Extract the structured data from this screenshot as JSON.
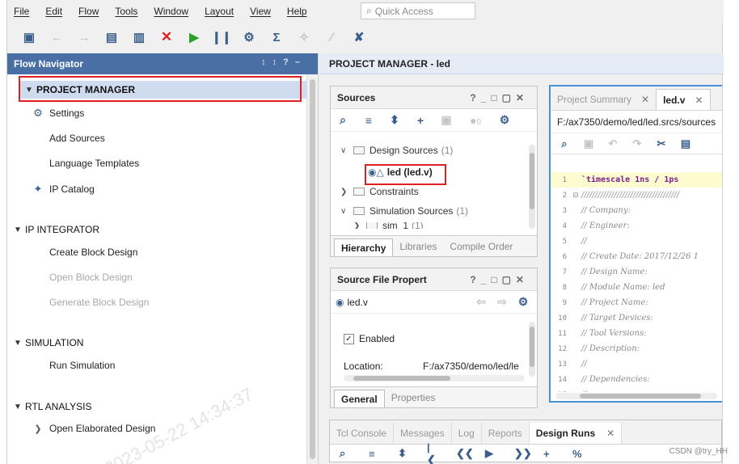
{
  "menubar": {
    "items": [
      "File",
      "Edit",
      "Flow",
      "Tools",
      "Window",
      "Layout",
      "View",
      "Help"
    ],
    "quick_access_placeholder": "Quick Access"
  },
  "toolbar": {
    "icons": [
      "open-project-icon",
      "undo-icon",
      "redo-icon",
      "copy-icon",
      "paste-icon",
      "delete-icon",
      "run-icon",
      "step-icon",
      "settings-icon",
      "sigma-icon",
      "disabled-tool-icon",
      "disabled-wand-icon",
      "disabled-cut-icon"
    ]
  },
  "flow_navigator": {
    "title": "Flow Navigator",
    "sections": [
      {
        "title": "PROJECT MANAGER",
        "items": [
          "Settings",
          "Add Sources",
          "Language Templates",
          "IP Catalog"
        ]
      },
      {
        "title": "IP INTEGRATOR",
        "items": [
          "Create Block Design",
          "Open Block Design",
          "Generate Block Design"
        ]
      },
      {
        "title": "SIMULATION",
        "items": [
          "Run Simulation"
        ]
      },
      {
        "title": "RTL ANALYSIS",
        "items": [
          "Open Elaborated Design"
        ]
      }
    ],
    "watermark": "2023-05-22 14:34:37"
  },
  "project_manager": {
    "title": "PROJECT MANAGER - led"
  },
  "sources": {
    "title": "Sources",
    "error_count": "0",
    "tree": {
      "design_sources": "Design Sources",
      "design_sources_count": "(1)",
      "led_file": "led (led.v)",
      "constraints": "Constraints",
      "simulation_sources": "Simulation Sources",
      "simulation_sources_count": "(1)",
      "sim": "sim_1",
      "sim_count": "(1)"
    },
    "tabs": [
      "Hierarchy",
      "Libraries",
      "Compile Order"
    ]
  },
  "file_properties": {
    "title": "Source File Propert",
    "file": "led.v",
    "enabled_label": "Enabled",
    "location_label": "Location:",
    "location_value": "F:/ax7350/demo/led/le",
    "tabs": [
      "General",
      "Properties"
    ]
  },
  "editor": {
    "tabs": [
      "Project Summary",
      "led.v"
    ],
    "path": "F:/ax7350/demo/led/led.srcs/sources",
    "lines": [
      "`timescale 1ns / 1ps",
      "////////////////////////////////////",
      "// Company:",
      "// Engineer:",
      "//",
      "// Create Date: 2017/12/26 1",
      "// Design Name:",
      "// Module Name: led",
      "// Project Name:",
      "// Target Devices:",
      "// Tool Versions:",
      "// Description:",
      "//",
      "// Dependencies:",
      "//"
    ]
  },
  "console": {
    "tabs": [
      "Tcl Console",
      "Messages",
      "Log",
      "Reports",
      "Design Runs"
    ]
  },
  "credit": "CSDN @try_HH"
}
